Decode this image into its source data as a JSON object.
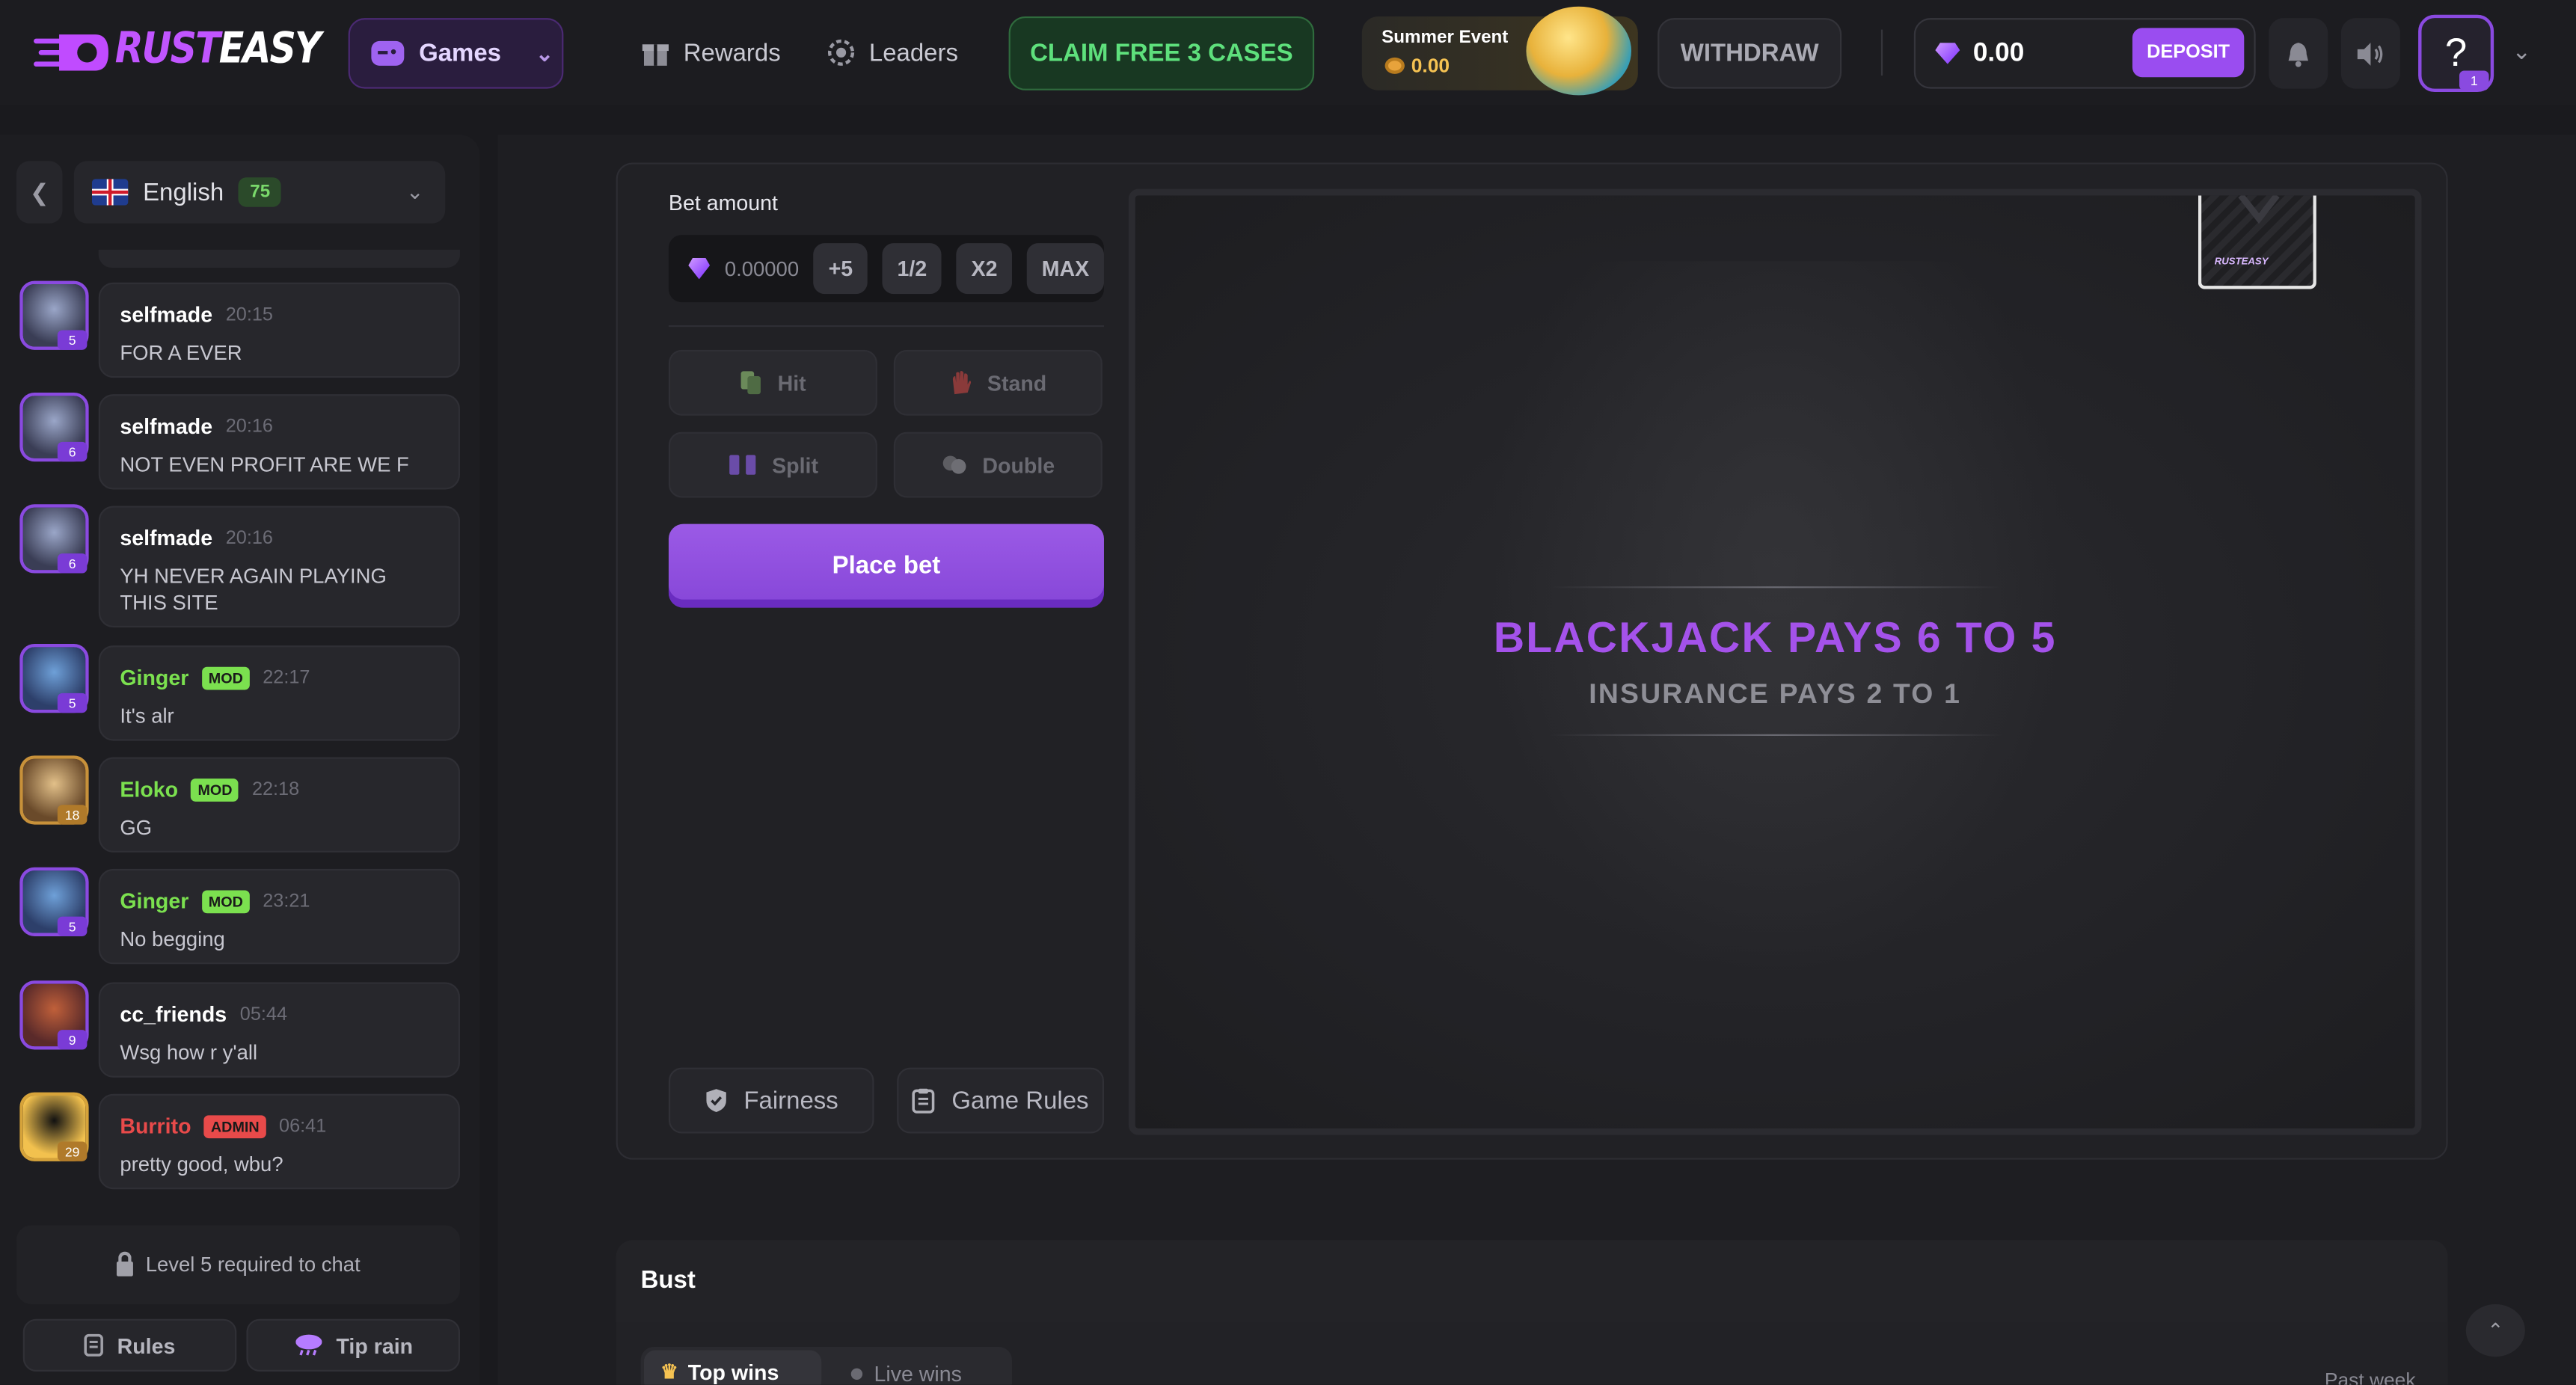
{
  "header": {
    "logo": {
      "part1": "RUST",
      "part2": "EASY"
    },
    "games_label": "Games",
    "nav": [
      {
        "label": "Rewards",
        "icon": "gift-icon"
      },
      {
        "label": "Leaders",
        "icon": "laurel-icon"
      }
    ],
    "claim_label": "CLAIM FREE 3 CASES",
    "summer_event": {
      "title": "Summer Event",
      "value": "0.00"
    },
    "withdraw_label": "WITHDRAW",
    "balance": "0.00",
    "deposit_label": "DEPOSIT",
    "help_label": "?",
    "help_badge": "1"
  },
  "sidebar": {
    "language": "English",
    "online_count": "75",
    "messages": [
      {
        "user": "selfmade",
        "time": "20:15",
        "text": "FOR A EVER",
        "level": "5",
        "role": ""
      },
      {
        "user": "selfmade",
        "time": "20:16",
        "text": "NOT EVEN PROFIT ARE WE F",
        "level": "6",
        "role": ""
      },
      {
        "user": "selfmade",
        "time": "20:16",
        "text": "YH NEVER AGAIN PLAYING THIS SITE",
        "level": "6",
        "role": ""
      },
      {
        "user": "Ginger",
        "time": "22:17",
        "text": "It's alr",
        "level": "5",
        "role": "MOD"
      },
      {
        "user": "Eloko",
        "time": "22:18",
        "text": "GG",
        "level": "18",
        "role": "MOD"
      },
      {
        "user": "Ginger",
        "time": "23:21",
        "text": "No begging",
        "level": "5",
        "role": "MOD"
      },
      {
        "user": "cc_friends",
        "time": "05:44",
        "text": "Wsg how r y'all",
        "level": "9",
        "role": ""
      },
      {
        "user": "Burrito",
        "time": "06:41",
        "text": "pretty good, wbu?",
        "level": "29",
        "role": "ADMIN"
      }
    ],
    "lock_text": "Level 5 required to chat",
    "rules_label": "Rules",
    "tip_rain_label": "Tip rain"
  },
  "game": {
    "bet_label": "Bet amount",
    "bet_value": "0.00000",
    "chips": [
      "+5",
      "1/2",
      "X2",
      "MAX"
    ],
    "actions": {
      "hit": "Hit",
      "stand": "Stand",
      "split": "Split",
      "double": "Double"
    },
    "place_bet": "Place bet",
    "fairness": "Fairness",
    "game_rules": "Game Rules",
    "deck_logo": "RUSTEASY",
    "title": "BLACKJACK PAYS 6 TO 5",
    "subtitle": "INSURANCE PAYS 2 TO 1"
  },
  "bust": {
    "title": "Bust",
    "tab_top": "Top wins",
    "tab_live": "Live wins",
    "period": "Past week"
  },
  "colors": {
    "accent": "#9a4df0",
    "mod": "#7be04f",
    "admin": "#e84a4a",
    "claim": "#5ee07c"
  }
}
